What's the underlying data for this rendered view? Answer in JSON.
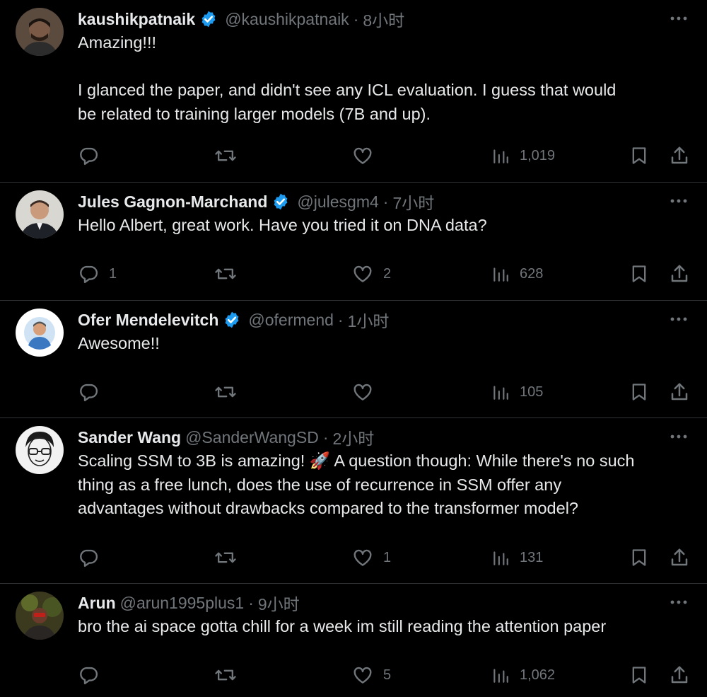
{
  "tweets": [
    {
      "name": "kaushikpatnaik",
      "verified": true,
      "handle": "@kaushikpatnaik",
      "time": "8小时",
      "lines": [
        "Amazing!!!",
        "",
        "I glanced the paper, and didn't see any ICL evaluation. I guess that would",
        "be related to training larger models (7B and up)."
      ],
      "replies": "",
      "retweets": "",
      "likes": "",
      "views": "1,019"
    },
    {
      "name": "Jules Gagnon-Marchand",
      "verified": true,
      "handle": "@julesgm4",
      "time": "7小时",
      "lines": [
        "Hello Albert, great work. Have you tried it on DNA data?"
      ],
      "replies": "1",
      "retweets": "",
      "likes": "2",
      "views": "628"
    },
    {
      "name": "Ofer Mendelevitch",
      "verified": true,
      "handle": "@ofermend",
      "time": "1小时",
      "lines": [
        "Awesome!!"
      ],
      "replies": "",
      "retweets": "",
      "likes": "",
      "views": "105"
    },
    {
      "name": "Sander Wang",
      "verified": false,
      "handle": "@SanderWangSD",
      "time": "2小时",
      "lines": [
        "Scaling SSM to 3B is amazing! 🚀 A question though: While there's no such",
        "thing as a free lunch, does the use of recurrence in SSM offer any",
        "advantages without drawbacks compared to the transformer model?"
      ],
      "replies": "",
      "retweets": "",
      "likes": "1",
      "views": "131"
    },
    {
      "name": "Arun",
      "verified": false,
      "handle": "@arun1995plus1",
      "time": "9小时",
      "lines": [
        "bro the ai space gotta chill for a week im still reading the attention paper"
      ],
      "replies": "",
      "retweets": "",
      "likes": "5",
      "views": "1,062"
    }
  ],
  "separator": "·",
  "icons": {
    "reply": "reply-icon",
    "retweet": "retweet-icon",
    "like": "heart-icon",
    "views": "views-icon",
    "bookmark": "bookmark-icon",
    "share": "share-icon",
    "more": "more-icon",
    "verified": "verified-badge-icon"
  },
  "colors": {
    "background": "#000000",
    "text": "#e7e9ea",
    "muted": "#71767b",
    "verified": "#1d9bf0",
    "divider": "#2f3336"
  }
}
